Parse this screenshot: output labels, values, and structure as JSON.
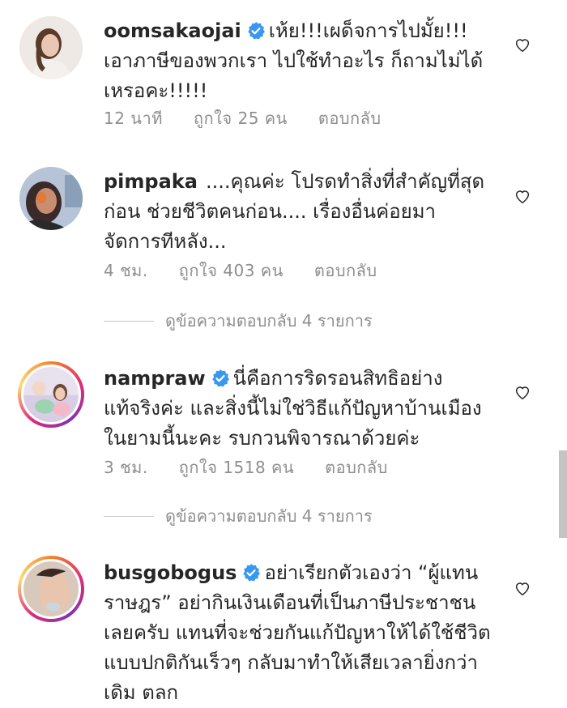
{
  "comments": [
    {
      "username": "oomsakaojai",
      "verified": true,
      "text": "เห้ย!!!เผด็จการไปมั้ย!!! เอาภาษีของพวกเรา ไปใช้ทำอะไร ก็ถามไม่ได้เหรอคะ!!!!!",
      "time": "12 นาที",
      "likes": "ถูกใจ 25 คน",
      "reply": "ตอบกลับ"
    },
    {
      "username": "pimpaka",
      "verified": false,
      "text": "....คุณค่ะ โปรดทำสิ่งที่สำคัญที่สุดก่อน ช่วยชีวิตคนก่อน.... เรื่องอื่นค่อยมาจัดการทีหลัง...",
      "time": "4 ชม.",
      "likes": "ถูกใจ 403 คน",
      "reply": "ตอบกลับ",
      "view_replies": "ดูข้อความตอบกลับ 4 รายการ"
    },
    {
      "username": "nampraw",
      "verified": true,
      "text": "นี่คือการริดรอนสิทธิอย่างแท้จริงค่ะ และสิ่งนี้ไม่ใช่วิธีแก้ปัญหาบ้านเมืองในยามนี้นะคะ รบกวนพิจารณาด้วยค่ะ",
      "time": "3 ชม.",
      "likes": "ถูกใจ 1518 คน",
      "reply": "ตอบกลับ",
      "view_replies": "ดูข้อความตอบกลับ 4 รายการ"
    },
    {
      "username": "busgobogus",
      "verified": true,
      "text": "อย่าเรียกตัวเองว่า “ผู้แทนราษฎร” อย่ากินเงินเดือนที่เป็นภาษีประชาชนเลยครับ แทนที่จะช่วยกันแก้ปัญหาให้ได้ใช้ชีวิตแบบปกติกันเร็วๆ กลับมาทำให้เสียเวลายิ่งกว่าเดิม ตลก"
    }
  ],
  "colors": {
    "verified": "#3897f0",
    "meta": "#8e8e8e",
    "text": "#262626"
  }
}
